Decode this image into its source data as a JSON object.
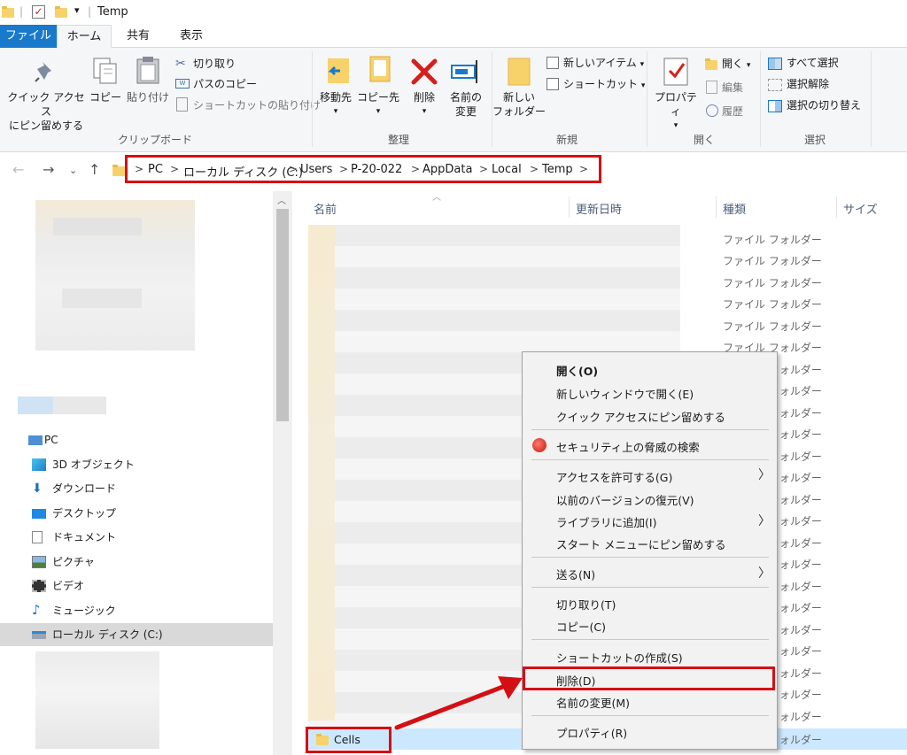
{
  "window": {
    "title": "Temp"
  },
  "tabs": [
    "ファイル",
    "ホーム",
    "共有",
    "表示"
  ],
  "ribbon": {
    "clipboard": {
      "pin_quick_access": [
        "クイック アクセス",
        "にピン留めする"
      ],
      "copy": "コピー",
      "paste": "貼り付け",
      "cut": "切り取り",
      "copy_path": "パスのコピー",
      "paste_shortcut": "ショートカットの貼り付け",
      "label": "クリップボード"
    },
    "organize": {
      "move_to": "移動先",
      "copy_to": "コピー先",
      "delete": "削除",
      "rename": [
        "名前の",
        "変更"
      ],
      "label": "整理"
    },
    "new": {
      "new_folder": [
        "新しい",
        "フォルダー"
      ],
      "new_item": "新しいアイテム",
      "shortcut": "ショートカット",
      "label": "新規"
    },
    "open": {
      "properties": "プロパティ",
      "open": "開く",
      "edit": "編集",
      "history": "履歴",
      "label": "開く"
    },
    "select": {
      "select_all": "すべて選択",
      "select_none": "選択解除",
      "invert": "選択の切り替え",
      "label": "選択"
    }
  },
  "address": {
    "crumbs": [
      "PC",
      "ローカル ディスク (C:)",
      "Users",
      "P-20-022",
      "AppData",
      "Local",
      "Temp"
    ]
  },
  "nav": {
    "items": [
      "PC",
      "3D オブジェクト",
      "ダウンロード",
      "デスクトップ",
      "ドキュメント",
      "ピクチャ",
      "ビデオ",
      "ミュージック",
      "ローカル ディスク (C:)"
    ]
  },
  "filelist": {
    "columns": [
      "名前",
      "更新日時",
      "種類",
      "サイズ"
    ],
    "type_value": "ファイル フォルダー",
    "selected_name": "Cells"
  },
  "context_menu": {
    "open": "開く(O)",
    "open_new_window": "新しいウィンドウで開く(E)",
    "pin_quick": "クイック アクセスにピン留めする",
    "scan": "セキュリティ上の脅威の検索",
    "give_access": "アクセスを許可する(G)",
    "restore": "以前のバージョンの復元(V)",
    "library": "ライブラリに追加(I)",
    "pin_start": "スタート メニューにピン留めする",
    "send_to": "送る(N)",
    "cut": "切り取り(T)",
    "copy": "コピー(C)",
    "create_shortcut": "ショートカットの作成(S)",
    "delete": "削除(D)",
    "rename": "名前の変更(M)",
    "properties": "プロパティ(R)"
  },
  "colors": {
    "accent": "#1979ca",
    "highlight": "#d40f14",
    "selected_row": "#cce8ff"
  }
}
